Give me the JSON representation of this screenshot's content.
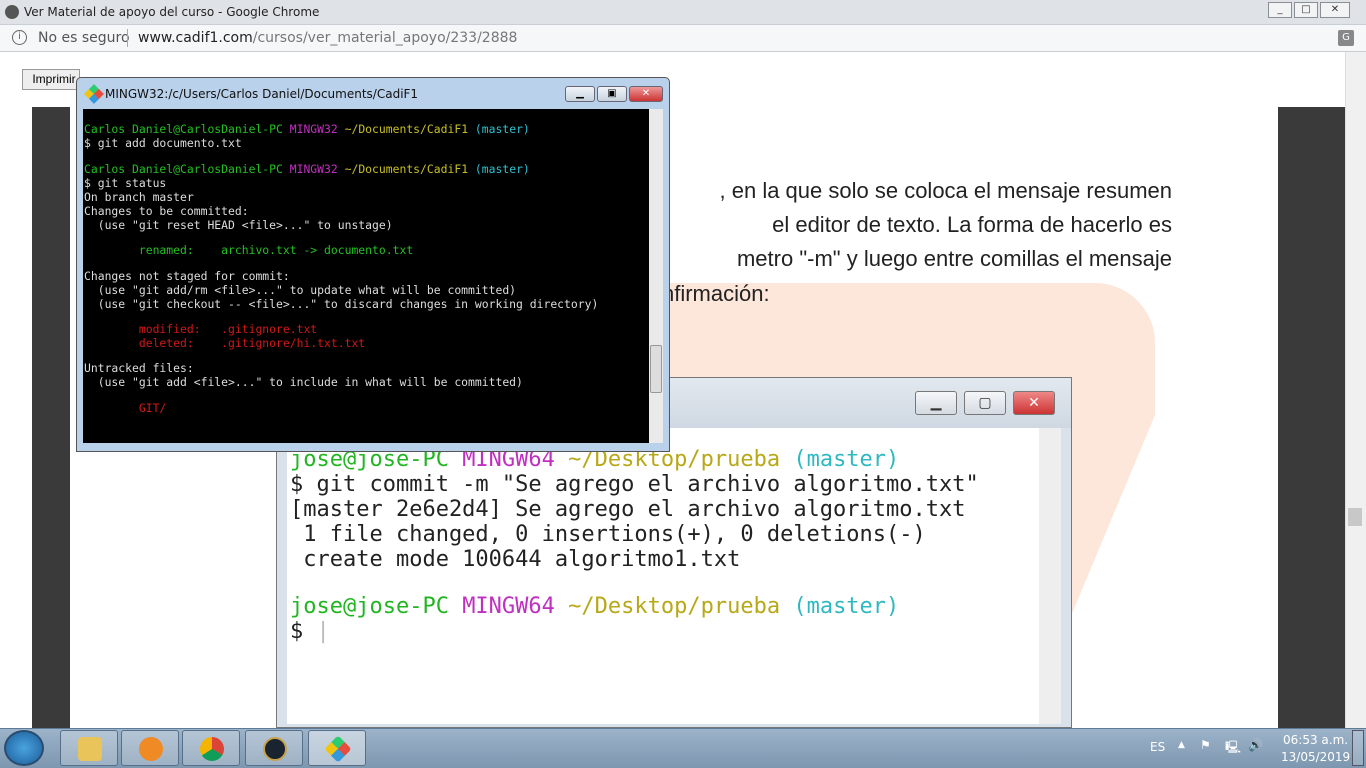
{
  "browser": {
    "title": "Ver Material de apoyo del curso - Google Chrome",
    "security": "No es seguro",
    "url_host": "www.cadif1.com",
    "url_path": "/cursos/ver_material_apoyo/233/2888",
    "window_buttons": [
      "minimize",
      "maximize",
      "close"
    ]
  },
  "page": {
    "print_button": "Imprimir",
    "paragraph": [
      ", en la que solo se coloca el mensaje resumen",
      "el editor de texto. La forma de hacerlo es",
      "metro \"-m\" y luego entre comillas el mensaje",
      "nfirmación:"
    ],
    "embedded_terminal": {
      "lines": [
        [
          {
            "t": "jose@jose-PC ",
            "c": "#22b522"
          },
          {
            "t": "MINGW64 ",
            "c": "#c030c0"
          },
          {
            "t": "~/Desktop/prueba ",
            "c": "#b8a818"
          },
          {
            "t": "(master)",
            "c": "#30b8c0"
          }
        ],
        [
          {
            "t": "$ git commit -m \"Se agrego el archivo algoritmo.txt\"",
            "c": "#222"
          }
        ],
        [
          {
            "t": "[master 2e6e2d4] Se agrego el archivo algoritmo.txt",
            "c": "#222"
          }
        ],
        [
          {
            "t": " 1 file changed, 0 insertions(+), 0 deletions(-)",
            "c": "#222"
          }
        ],
        [
          {
            "t": " create mode 100644 algoritmo1.txt",
            "c": "#222"
          }
        ],
        [
          {
            "t": "",
            "c": "#222"
          }
        ],
        [
          {
            "t": "jose@jose-PC ",
            "c": "#22b522"
          },
          {
            "t": "MINGW64 ",
            "c": "#c030c0"
          },
          {
            "t": "~/Desktop/prueba ",
            "c": "#b8a818"
          },
          {
            "t": "(master)",
            "c": "#30b8c0"
          }
        ],
        [
          {
            "t": "$ ",
            "c": "#222"
          }
        ]
      ]
    }
  },
  "gitbash": {
    "title": "MINGW32:/c/Users/Carlos Daniel/Documents/CadiF1",
    "lines": [
      [
        {
          "t": "",
          "c": "#ddd"
        }
      ],
      [
        {
          "t": "Carlos Daniel@CarlosDaniel-PC ",
          "c": "#22c022"
        },
        {
          "t": "MINGW32 ",
          "c": "#c030c0"
        },
        {
          "t": "~/Documents/CadiF1 ",
          "c": "#c8c020"
        },
        {
          "t": "(master)",
          "c": "#30c0d0"
        }
      ],
      [
        {
          "t": "$ git add documento.txt",
          "c": "#ddd"
        }
      ],
      [
        {
          "t": "",
          "c": "#ddd"
        }
      ],
      [
        {
          "t": "Carlos Daniel@CarlosDaniel-PC ",
          "c": "#22c022"
        },
        {
          "t": "MINGW32 ",
          "c": "#c030c0"
        },
        {
          "t": "~/Documents/CadiF1 ",
          "c": "#c8c020"
        },
        {
          "t": "(master)",
          "c": "#30c0d0"
        }
      ],
      [
        {
          "t": "$ git status",
          "c": "#ddd"
        }
      ],
      [
        {
          "t": "On branch master",
          "c": "#ddd"
        }
      ],
      [
        {
          "t": "Changes to be committed:",
          "c": "#ddd"
        }
      ],
      [
        {
          "t": "  (use \"git reset HEAD <file>...\" to unstage)",
          "c": "#ddd"
        }
      ],
      [
        {
          "t": "",
          "c": "#ddd"
        }
      ],
      [
        {
          "t": "        renamed:    archivo.txt -> documento.txt",
          "c": "#22c022"
        }
      ],
      [
        {
          "t": "",
          "c": "#ddd"
        }
      ],
      [
        {
          "t": "Changes not staged for commit:",
          "c": "#ddd"
        }
      ],
      [
        {
          "t": "  (use \"git add/rm <file>...\" to update what will be committed)",
          "c": "#ddd"
        }
      ],
      [
        {
          "t": "  (use \"git checkout -- <file>...\" to discard changes in working directory)",
          "c": "#ddd"
        }
      ],
      [
        {
          "t": "",
          "c": "#ddd"
        }
      ],
      [
        {
          "t": "        modified:   .gitignore.txt",
          "c": "#d01818"
        }
      ],
      [
        {
          "t": "        deleted:    .gitignore/hi.txt.txt",
          "c": "#d01818"
        }
      ],
      [
        {
          "t": "",
          "c": "#ddd"
        }
      ],
      [
        {
          "t": "Untracked files:",
          "c": "#ddd"
        }
      ],
      [
        {
          "t": "  (use \"git add <file>...\" to include in what will be committed)",
          "c": "#ddd"
        }
      ],
      [
        {
          "t": "",
          "c": "#ddd"
        }
      ],
      [
        {
          "t": "        GIT/",
          "c": "#d01818"
        }
      ]
    ]
  },
  "taskbar": {
    "apps": [
      "file-explorer",
      "media-player",
      "google-chrome",
      "league-of-legends",
      "git-bash"
    ],
    "language": "ES",
    "time": "06:53 a.m.",
    "date": "13/05/2019"
  }
}
